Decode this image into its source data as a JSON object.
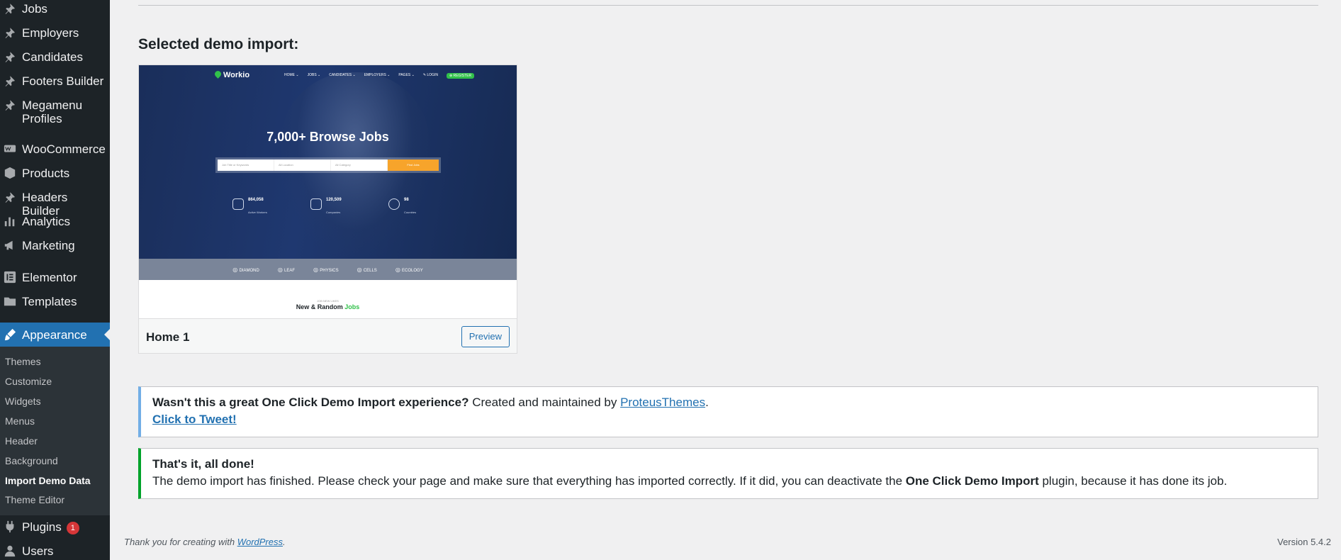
{
  "sidebar": {
    "items": [
      {
        "label": "Jobs",
        "icon": "pin-icon"
      },
      {
        "label": "Employers",
        "icon": "pin-icon"
      },
      {
        "label": "Candidates",
        "icon": "pin-icon"
      },
      {
        "label": "Footers Builder",
        "icon": "pin-icon"
      },
      {
        "label": "Megamenu Profiles",
        "icon": "pin-icon"
      },
      {
        "label": "WooCommerce",
        "icon": "woo-icon"
      },
      {
        "label": "Products",
        "icon": "box-icon"
      },
      {
        "label": "Headers Builder",
        "icon": "pin-icon"
      },
      {
        "label": "Analytics",
        "icon": "bar-chart-icon"
      },
      {
        "label": "Marketing",
        "icon": "megaphone-icon"
      },
      {
        "label": "Elementor",
        "icon": "elementor-icon"
      },
      {
        "label": "Templates",
        "icon": "folder-icon"
      },
      {
        "label": "Appearance",
        "icon": "brush-icon"
      },
      {
        "label": "Plugins",
        "icon": "plug-icon",
        "badge": "1"
      },
      {
        "label": "Users",
        "icon": "user-icon"
      }
    ],
    "submenu": [
      "Themes",
      "Customize",
      "Widgets",
      "Menus",
      "Header",
      "Background",
      "Import Demo Data",
      "Theme Editor"
    ],
    "current_sub": "Import Demo Data"
  },
  "main": {
    "section_title": "Selected demo import:",
    "demo": {
      "name": "Home 1",
      "preview_label": "Preview",
      "screenshot": {
        "logo": "Workio",
        "nav": [
          "HOME ⌄",
          "JOBS ⌄",
          "CANDIDATES ⌄",
          "EMPLOYERS ⌄",
          "PAGES ⌄",
          "✎ LOGIN",
          "⊕ REGISTER"
        ],
        "headline": "7,000+ Browse Jobs",
        "search_fields": [
          "Job Title or Keywords",
          "All Location",
          "All Category"
        ],
        "search_button": "Find Jobs",
        "stats": [
          {
            "num": "864,058",
            "cap": "Active Workers"
          },
          {
            "num": "120,509",
            "cap": "Companies"
          },
          {
            "num": "98",
            "cap": "Countries"
          }
        ],
        "partners": [
          "DIAMOND",
          "LEAF",
          "PHYSICS",
          "CELLS",
          "ECOLOGY"
        ],
        "lower_small": "JOB NEW LIKES",
        "lower_big_prefix": "New & Random ",
        "lower_big_accent": "Jobs"
      }
    },
    "notice_tweet": {
      "strong": "Wasn't this a great One Click Demo Import experience?",
      "text": " Created and maintained by ",
      "link": "ProteusThemes",
      "period": ".",
      "tweet_link": "Click to Tweet!"
    },
    "notice_done": {
      "title": "That's it, all done!",
      "text_before": "The demo import has finished. Please check your page and make sure that everything has imported correctly. If it did, you can deactivate the ",
      "strong": "One Click Demo Import",
      "text_after": " plugin, because it has done its job."
    }
  },
  "footer": {
    "thanks_prefix": "Thank you for creating with ",
    "thanks_link": "WordPress",
    "thanks_suffix": ".",
    "version": "Version 5.4.2"
  },
  "colors": {
    "sidebar_bg": "#1d2327",
    "accent": "#2271b1",
    "success": "#00a32a",
    "info": "#72aee6",
    "badge": "#d63638"
  }
}
